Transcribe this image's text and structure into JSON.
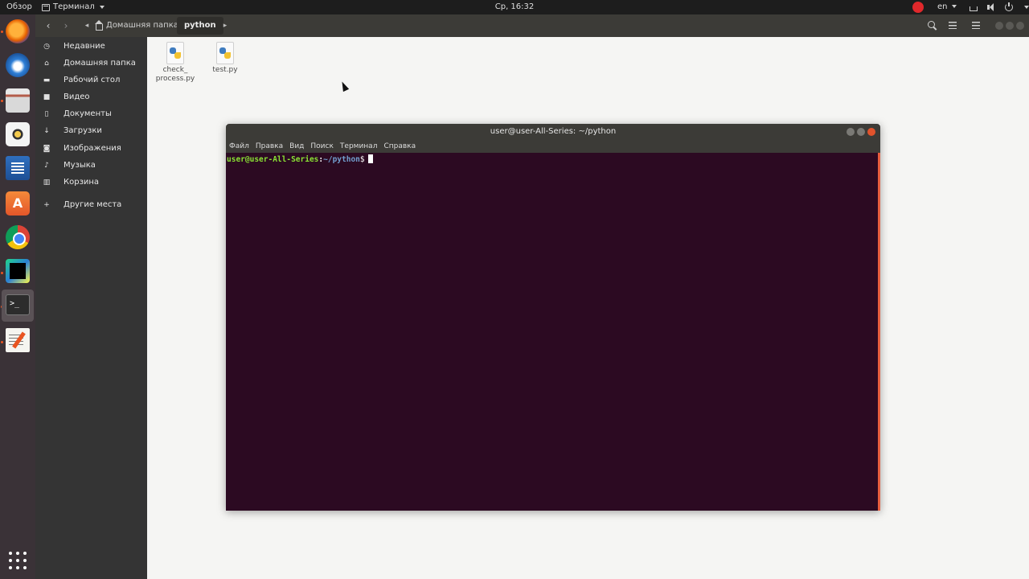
{
  "topbar": {
    "activities": "Обзор",
    "app_menu": "Терминал",
    "clock": "Ср, 16:32",
    "lang": "en"
  },
  "dock": {
    "apps": [
      "firefox-icon",
      "thunderbird-icon",
      "files-icon",
      "rhythmbox-icon",
      "writer-icon",
      "software-icon",
      "chrome-icon",
      "pycharm-icon",
      "terminal-icon",
      "text-editor-icon"
    ],
    "terminal_glyph": ">_"
  },
  "file_manager": {
    "breadcrumb": {
      "home": "Домашняя папка",
      "current": "python"
    },
    "sidebar": {
      "items": [
        {
          "label": "Недавние",
          "icon": "recent-icon"
        },
        {
          "label": "Домашняя папка",
          "icon": "home-icon"
        },
        {
          "label": "Рабочий стол",
          "icon": "desktop-icon"
        },
        {
          "label": "Видео",
          "icon": "video-icon"
        },
        {
          "label": "Документы",
          "icon": "documents-icon"
        },
        {
          "label": "Загрузки",
          "icon": "downloads-icon"
        },
        {
          "label": "Изображения",
          "icon": "pictures-icon"
        },
        {
          "label": "Музыка",
          "icon": "music-icon"
        },
        {
          "label": "Корзина",
          "icon": "trash-icon"
        },
        {
          "label": "Другие места",
          "icon": "plus-icon"
        }
      ]
    },
    "files": [
      {
        "line1": "check_",
        "line2": "process.py"
      },
      {
        "line1": "test.py",
        "line2": ""
      }
    ]
  },
  "terminal": {
    "title": "user@user-All-Series: ~/python",
    "menu": [
      "Файл",
      "Правка",
      "Вид",
      "Поиск",
      "Терминал",
      "Справка"
    ],
    "prompt": {
      "user_host": "user@user-All-Series",
      "colon": ":",
      "path": "~/python",
      "dollar": "$"
    }
  },
  "colors": {
    "terminal_bg": "#2c0a22",
    "prompt_user": "#8ae234",
    "prompt_path": "#729fcf",
    "accent": "#e95420"
  }
}
